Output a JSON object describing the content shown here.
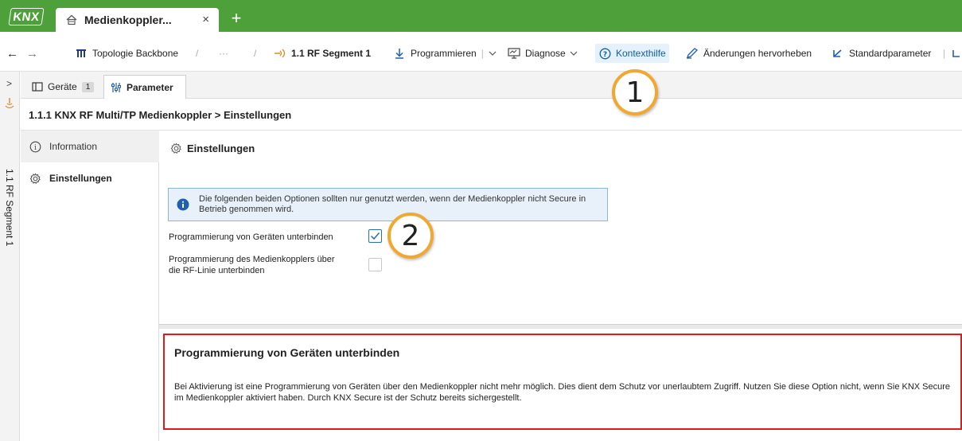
{
  "titlebar": {
    "logo_text": "KNX",
    "tab_title": "Medienkoppler...",
    "tab_close": "×",
    "new_tab": "+"
  },
  "toolbar": {
    "back": "←",
    "forward": "→",
    "crumb1": "Topologie Backbone",
    "sep1": "/",
    "ellipsis": "···",
    "sep2": "/",
    "crumb3": "1.1 RF Segment 1",
    "programmieren": "Programmieren",
    "diagnose": "Diagnose",
    "kontexthilfe": "Kontexthilfe",
    "aenderungen": "Änderungen hervorheben",
    "standardparameter": "Standardparameter"
  },
  "rail": {
    "expand": ">",
    "label": "1.1 RF Segment 1"
  },
  "panel_tabs": {
    "geraete": "Geräte",
    "geraete_count": "1",
    "parameter": "Parameter"
  },
  "breadcrumb": "1.1.1 KNX RF Multi/TP Medienkoppler > Einstellungen",
  "nav": {
    "information": "Information",
    "einstellungen": "Einstellungen"
  },
  "content": {
    "section_title": "Einstellungen",
    "info_text": "Die folgenden beiden Optionen sollten nur genutzt werden, wenn der Medienkoppler nicht Secure in Betrieb genommen wird.",
    "option1_label": "Programmierung von Geräten unterbinden",
    "option1_checked": true,
    "option2_label_line1": "Programmierung des Medienkopplers über",
    "option2_label_line2": "die RF-Linie unterbinden",
    "option2_checked": false
  },
  "callouts": {
    "one": "1",
    "two": "2"
  },
  "help": {
    "title": "Programmierung von Geräten unterbinden",
    "body": "Bei Aktivierung ist eine Programmierung von Geräten über den Medienkoppler nicht mehr möglich. Dies dient dem Schutz vor unerlaubtem Zugriff. Nutzen Sie diese Option nicht, wenn Sie KNX Secure im Medienkoppler aktiviert haben. Durch KNX Secure ist der Schutz bereits sichergestellt."
  },
  "colors": {
    "titlebar": "#4ea03a",
    "accent": "#0e5ea8",
    "callout": "#f0a830",
    "help_border": "#e21a1a"
  }
}
